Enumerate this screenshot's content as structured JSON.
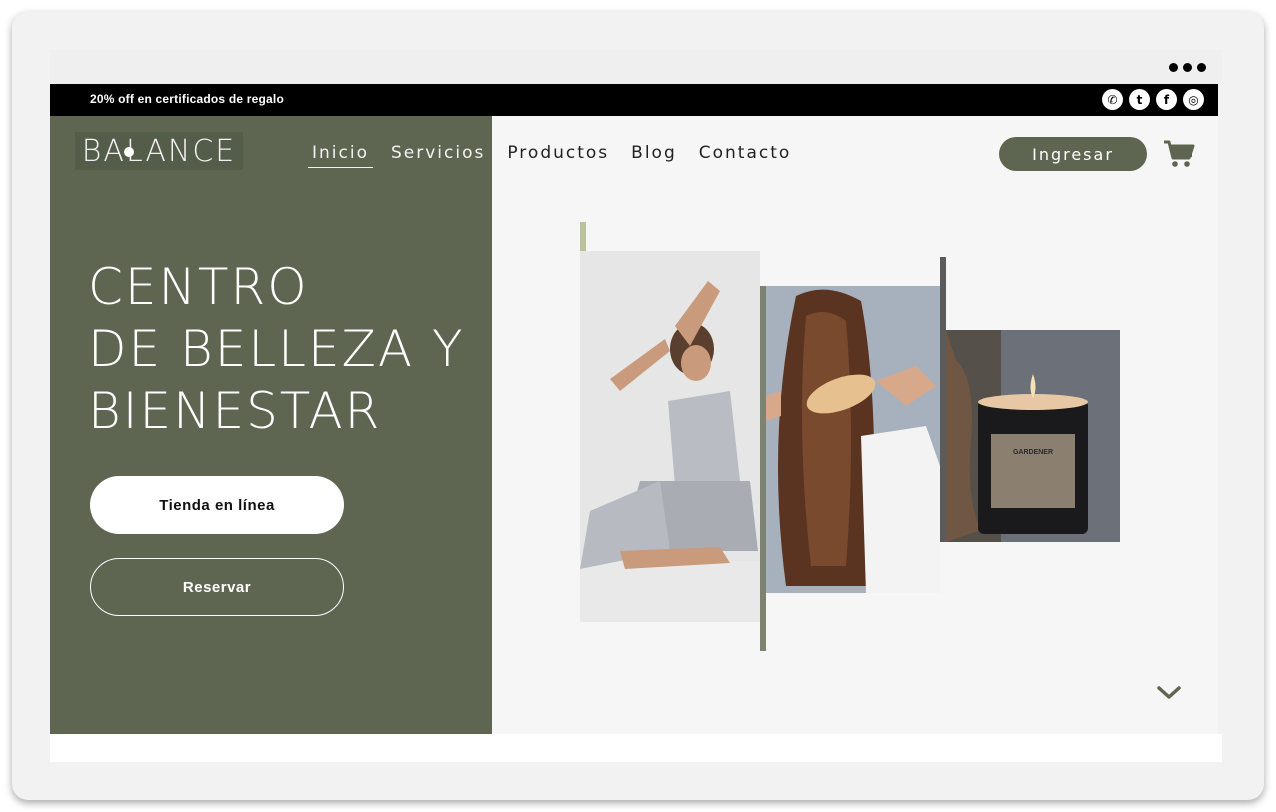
{
  "promo_bar": {
    "text": "20% off en certificados de regalo",
    "socials": [
      {
        "icon": "whatsapp-icon",
        "glyph": "✆"
      },
      {
        "icon": "twitter-icon",
        "glyph": "t"
      },
      {
        "icon": "facebook-icon",
        "glyph": "f"
      },
      {
        "icon": "instagram-icon",
        "glyph": "◎"
      }
    ]
  },
  "header": {
    "logo": "BALANCE",
    "nav": [
      "Inicio",
      "Servicios",
      "Productos",
      "Blog",
      "Contacto"
    ],
    "active_nav": "Inicio",
    "login_label": "Ingresar",
    "cart_icon": "cart-icon"
  },
  "hero": {
    "title_lines": [
      "CENTRO",
      "DE BELLEZA Y",
      "BIENESTAR"
    ],
    "primary_button": "Tienda en línea",
    "secondary_button": "Reservar"
  },
  "gallery": {
    "candle_label": "GARDENER"
  },
  "colors": {
    "brand_green": "#5e6652",
    "accent_sage": "#b9c29c",
    "background": "#f6f6f6"
  }
}
